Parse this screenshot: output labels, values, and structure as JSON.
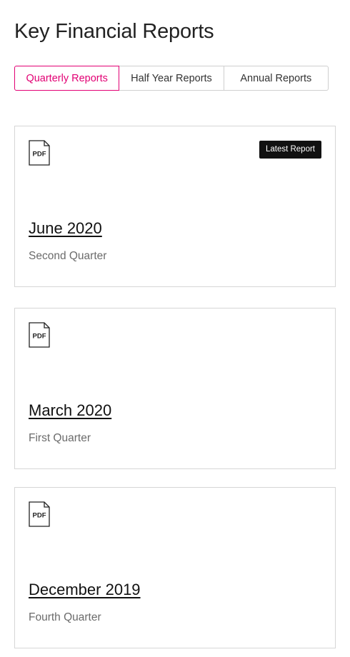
{
  "page": {
    "title": "Key Financial Reports"
  },
  "tabs": [
    {
      "label": "Quarterly Reports",
      "active": true
    },
    {
      "label": "Half Year Reports",
      "active": false
    },
    {
      "label": "Annual Reports",
      "active": false
    }
  ],
  "reports": [
    {
      "icon": "pdf-file-icon",
      "icon_text": "PDF",
      "badge": "Latest Report",
      "title": "June 2020",
      "subtitle": "Second Quarter"
    },
    {
      "icon": "pdf-file-icon",
      "icon_text": "PDF",
      "title": "March 2020",
      "subtitle": "First Quarter"
    },
    {
      "icon": "pdf-file-icon",
      "icon_text": "PDF",
      "title": "December 2019",
      "subtitle": "Fourth Quarter"
    }
  ],
  "colors": {
    "accent": "#e20074",
    "badge_bg": "#111111",
    "border": "#d6d6d6",
    "muted_text": "#6b6b6b"
  }
}
